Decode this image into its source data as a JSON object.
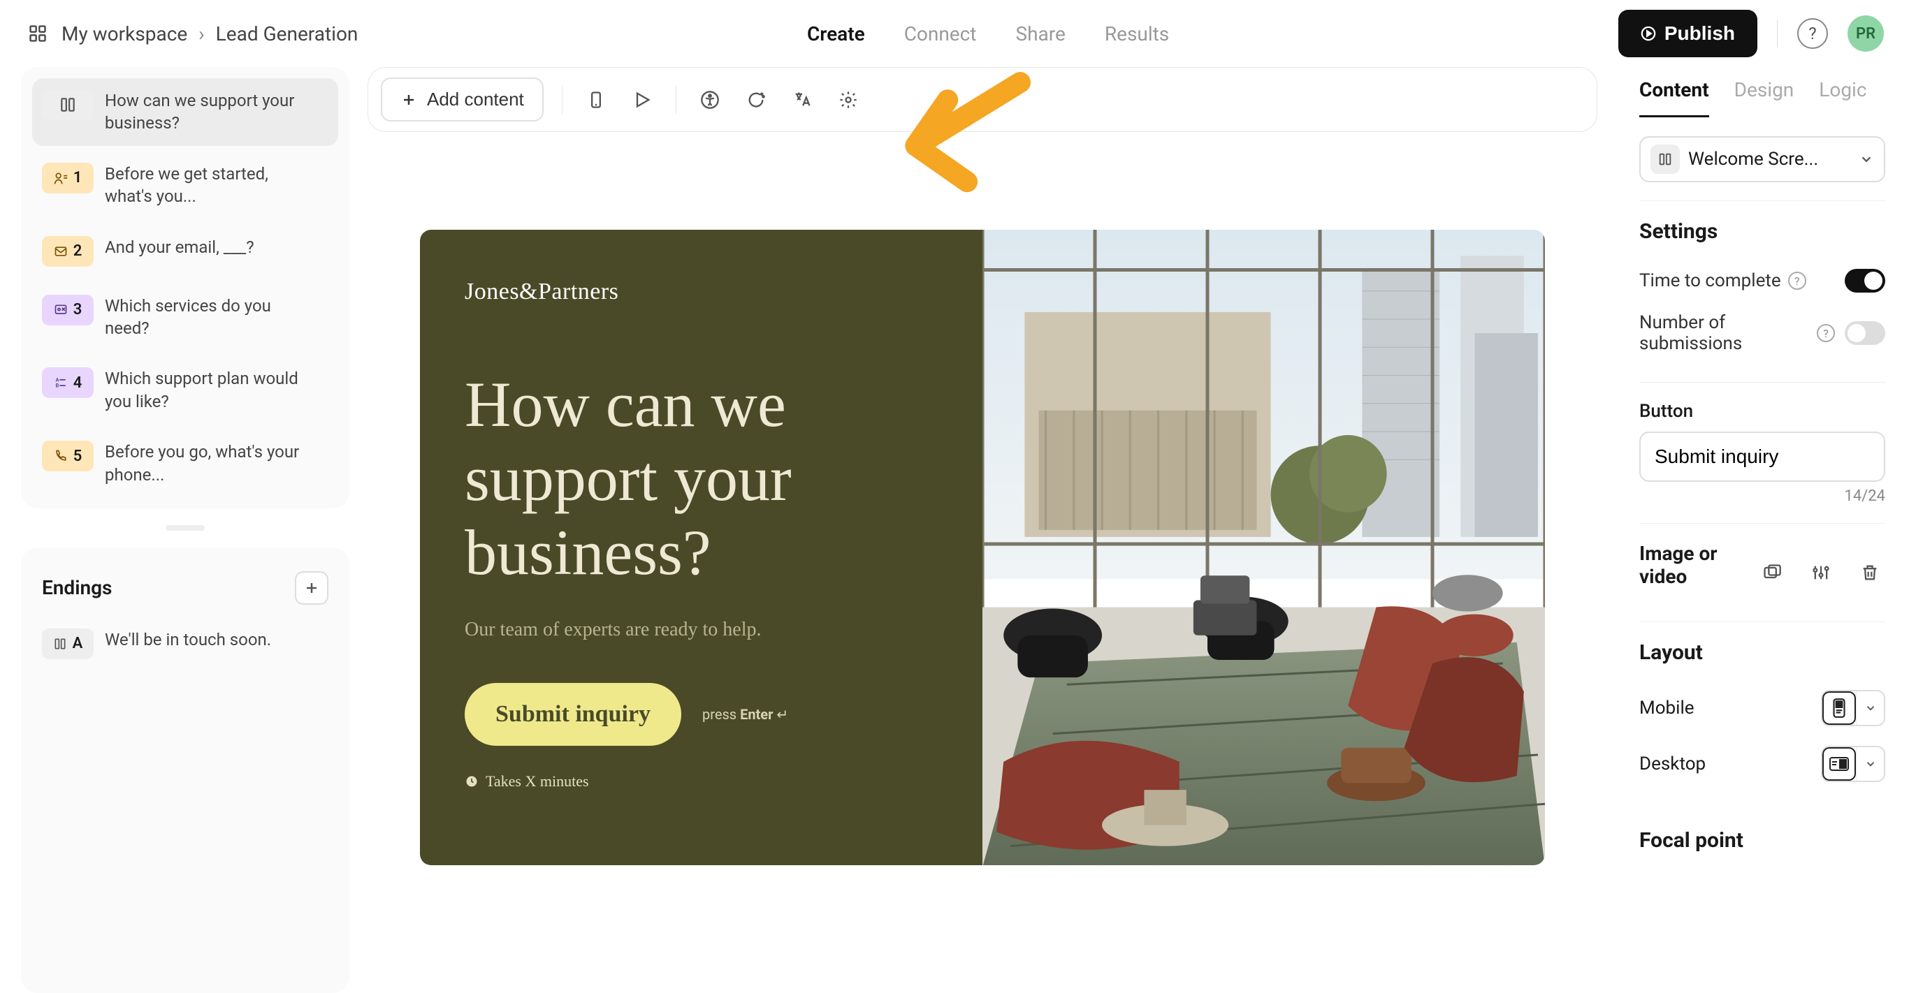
{
  "breadcrumb": {
    "workspace": "My workspace",
    "page": "Lead Generation"
  },
  "topnav": {
    "create": "Create",
    "connect": "Connect",
    "share": "Share",
    "results": "Results"
  },
  "publish_label": "Publish",
  "avatar_initials": "PR",
  "toolbar": {
    "add_content_label": "Add content"
  },
  "sidebar": {
    "questions": [
      {
        "label": "How can we support your business?"
      },
      {
        "num": "1",
        "label": "Before we get started, what's you..."
      },
      {
        "num": "2",
        "label": "And your email, ___?"
      },
      {
        "num": "3",
        "label": "Which services do you need?"
      },
      {
        "num": "4",
        "label": "Which support plan would you like?"
      },
      {
        "num": "5",
        "label": "Before you go, what's your phone..."
      }
    ],
    "endings_heading": "Endings",
    "endings": [
      {
        "badge": "A",
        "label": "We'll be in touch soon."
      }
    ]
  },
  "preview": {
    "brand": "Jones&Partners",
    "title": "How can we support your business?",
    "subtitle": "Our team of experts are ready to help.",
    "cta": "Submit inquiry",
    "hint_prefix": "press ",
    "hint_key": "Enter",
    "hint_glyph": " ↵",
    "takes": "Takes X minutes"
  },
  "rightpanel": {
    "tabs": {
      "content": "Content",
      "design": "Design",
      "logic": "Logic"
    },
    "screen_selector": "Welcome Scre...",
    "settings_heading": "Settings",
    "time_to_complete": "Time to complete",
    "number_of_submissions": "Number of submissions",
    "button_heading": "Button",
    "button_value": "Submit inquiry",
    "button_counter": "14/24",
    "media_heading": "Image or video",
    "layout_heading": "Layout",
    "mobile": "Mobile",
    "desktop": "Desktop",
    "focal_heading": "Focal point"
  }
}
